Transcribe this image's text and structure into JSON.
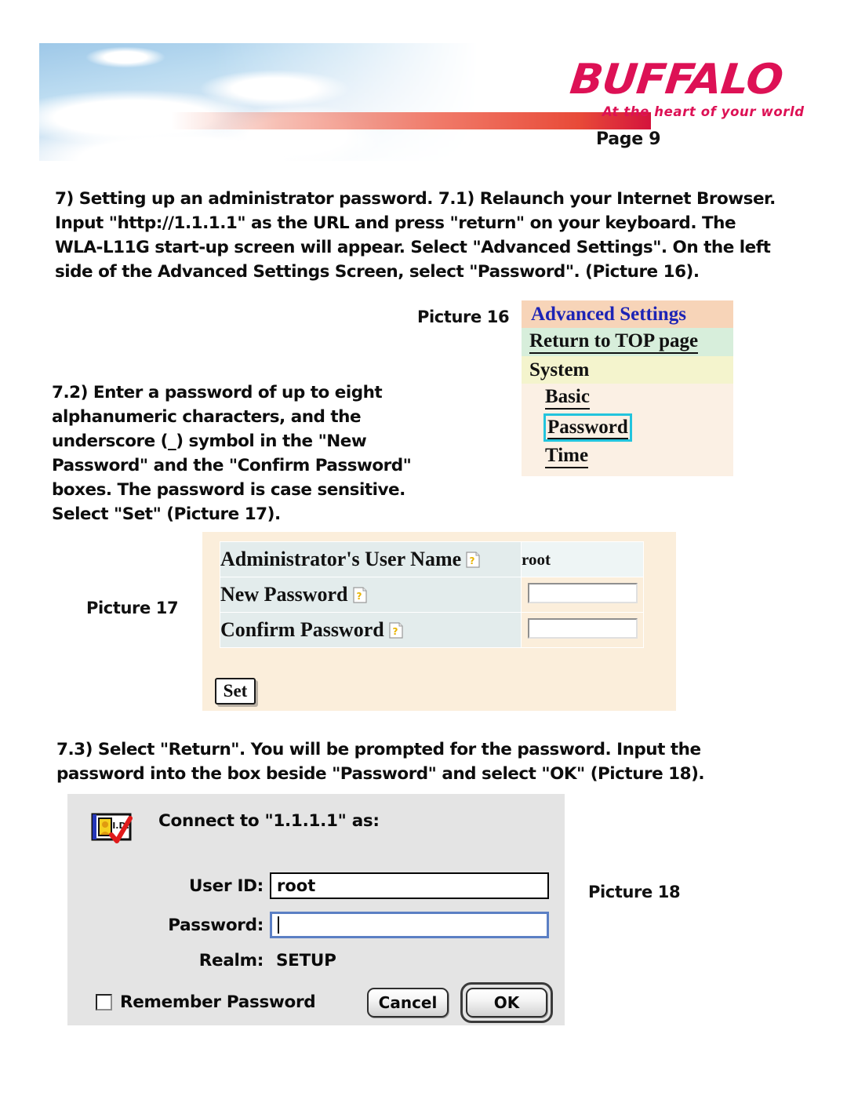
{
  "header": {
    "logo_text": "BUFFALO",
    "tagline": "At the heart of your world",
    "page_number": "Page 9",
    "brand_color": "#dd1155"
  },
  "body": {
    "para1": "7)  Setting up an administrator password.\n7.1)  Relaunch your Internet Browser.  Input \"http://1.1.1.1\" as the URL and press \"return\" on your keyboard.  The WLA-L11G start-up screen will appear.  Select \"Advanced Settings\".  On the left side of the Advanced Settings Screen, select \"Password\".\n(Picture 16).",
    "para2": "7.2) Enter a password of up to eight alphanumeric characters, and the underscore (_) symbol in the \"New Password\" and the \"Confirm Password\" boxes.  The password is case sensitive.  Select \"Set\" (Picture 17).",
    "para3": "7.3) Select \"Return\".  You will be prompted for the password.  Input the password into the box beside \"Password\" and select \"OK\" (Picture 18)."
  },
  "picture16": {
    "caption": "Picture 16",
    "menu": [
      {
        "label": "Advanced Settings",
        "bg": "#f7d4b8",
        "color": "#1d24b5"
      },
      {
        "label": "Return to TOP page",
        "bg": "#d7eedb",
        "color": "#111111"
      },
      {
        "label": "System",
        "bg": "#f4f4cd",
        "color": "#111111"
      },
      {
        "label": "Basic",
        "bg": "#fbf0e4",
        "color": "#111111"
      },
      {
        "label": "Password",
        "bg": "#fbf0e4",
        "color": "#111111",
        "highlight": "#22c4dd"
      },
      {
        "label": "Time",
        "bg": "#fbf0e4",
        "color": "#111111"
      }
    ]
  },
  "picture17": {
    "caption": "Picture 17",
    "rows": [
      {
        "label": "Administrator's User Name",
        "value": "root",
        "type": "text"
      },
      {
        "label": "New Password",
        "value": "",
        "type": "input"
      },
      {
        "label": "Confirm Password",
        "value": "",
        "type": "input"
      }
    ],
    "set_button": "Set",
    "panel_bg": "#fbeedb"
  },
  "picture18": {
    "caption": "Picture 18",
    "title": "Connect to \"1.1.1.1\" as:",
    "user_id_label": "User ID:",
    "user_id_value": "root",
    "password_label": "Password:",
    "password_value": "",
    "realm_label": "Realm:",
    "realm_value": "SETUP",
    "remember_label": "Remember Password",
    "remember_checked": false,
    "cancel_button": "Cancel",
    "ok_button": "OK",
    "dialog_bg": "#e4e4e4",
    "focus_color": "#5b7fc4"
  }
}
